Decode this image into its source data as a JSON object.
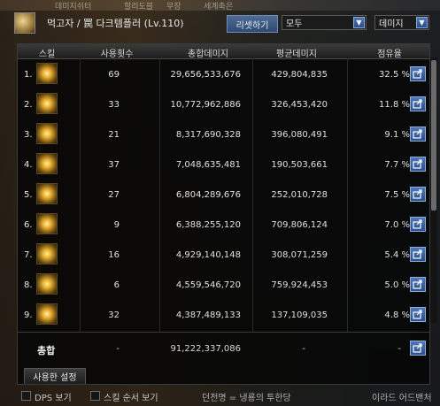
{
  "header": {
    "character": "먹고자 / 罠 다크템플러 (Lv.110)",
    "reset_button": "리셋하기",
    "filter_target": "모두",
    "filter_metric": "데미지"
  },
  "background_text": [
    "데미지쉬터",
    "할리도블",
    "무장",
    "세계축은"
  ],
  "table": {
    "columns": [
      "스킬",
      "사용횟수",
      "총합데미지",
      "평균데미지",
      "점유율"
    ],
    "rows": [
      {
        "rank": "1.",
        "uses": "69",
        "total": "29,656,533,676",
        "avg": "429,804,835",
        "share": "32.5 %"
      },
      {
        "rank": "2.",
        "uses": "33",
        "total": "10,772,962,886",
        "avg": "326,453,420",
        "share": "11.8 %"
      },
      {
        "rank": "3.",
        "uses": "21",
        "total": "8,317,690,328",
        "avg": "396,080,491",
        "share": "9.1 %"
      },
      {
        "rank": "4.",
        "uses": "37",
        "total": "7,048,635,481",
        "avg": "190,503,661",
        "share": "7.7 %"
      },
      {
        "rank": "5.",
        "uses": "27",
        "total": "6,804,289,676",
        "avg": "252,010,728",
        "share": "7.5 %"
      },
      {
        "rank": "6.",
        "uses": "9",
        "total": "6,388,255,120",
        "avg": "709,806,124",
        "share": "7.0 %"
      },
      {
        "rank": "7.",
        "uses": "16",
        "total": "4,929,140,148",
        "avg": "308,071,259",
        "share": "5.4 %"
      },
      {
        "rank": "8.",
        "uses": "6",
        "total": "4,559,546,720",
        "avg": "759,924,453",
        "share": "5.0 %"
      },
      {
        "rank": "9.",
        "uses": "32",
        "total": "4,387,489,133",
        "avg": "137,109,035",
        "share": "4.8 %"
      }
    ],
    "total": {
      "label": "총합",
      "uses": "-",
      "total": "91,222,337,086",
      "avg": "-",
      "share": "-"
    }
  },
  "tabs": {
    "used_settings": "사용한 설정"
  },
  "footer": {
    "dps_label": "DPS 보기",
    "skill_order_label": "스킬 순서 보기",
    "dungeon_text": "던전명 = 냉룡의 투한당",
    "right_text": "이라드 어드밴처"
  }
}
